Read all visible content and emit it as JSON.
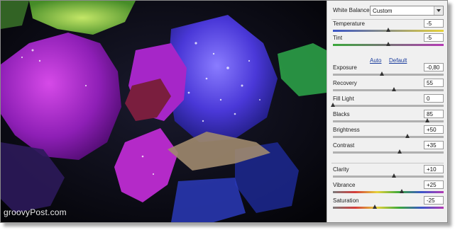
{
  "watermark": "groovyPost.com",
  "white_balance": {
    "label": "White Balance:",
    "value": "Custom"
  },
  "links": {
    "auto": "Auto",
    "default": "Default"
  },
  "sliders": [
    {
      "id": "temperature",
      "label": "Temperature",
      "value": "-5",
      "level": 0.5,
      "track": "linear-gradient(to right,#3a55c8,#e6d23a)"
    },
    {
      "id": "tint",
      "label": "Tint",
      "value": "-5",
      "level": 0.5,
      "track": "linear-gradient(to right,#3aa83a,#b43ab4)"
    },
    {
      "id": "exposure",
      "label": "Exposure",
      "value": "-0,80",
      "level": 0.44,
      "track": "linear-gradient(to right,#b0b0b0,#b0b0b0)"
    },
    {
      "id": "recovery",
      "label": "Recovery",
      "value": "55",
      "level": 0.55,
      "track": "linear-gradient(to right,#b0b0b0,#b0b0b0)"
    },
    {
      "id": "fill-light",
      "label": "Fill Light",
      "value": "0",
      "level": 0.0,
      "track": "linear-gradient(to right,#b0b0b0,#b0b0b0)"
    },
    {
      "id": "blacks",
      "label": "Blacks",
      "value": "85",
      "level": 0.85,
      "track": "linear-gradient(to right,#b0b0b0,#b0b0b0)"
    },
    {
      "id": "brightness",
      "label": "Brightness",
      "value": "+50",
      "level": 0.67,
      "track": "linear-gradient(to right,#b0b0b0,#b0b0b0)"
    },
    {
      "id": "contrast",
      "label": "Contrast",
      "value": "+35",
      "level": 0.6,
      "track": "linear-gradient(to right,#b0b0b0,#b0b0b0)"
    },
    {
      "id": "clarity",
      "label": "Clarity",
      "value": "+10",
      "level": 0.55,
      "track": "linear-gradient(to right,#b0b0b0,#b0b0b0)"
    },
    {
      "id": "vibrance",
      "label": "Vibrance",
      "value": "+25",
      "level": 0.62,
      "track": "linear-gradient(to right,#7a7a7a,#d43a3a,#e6d23a,#3aa83a,#3a55c8,#b43ab4)"
    },
    {
      "id": "saturation",
      "label": "Saturation",
      "value": "-25",
      "level": 0.38,
      "track": "linear-gradient(to right,#7a7a7a,#d43a3a,#e6d23a,#3aa83a,#3a55c8,#b43ab4)"
    }
  ]
}
